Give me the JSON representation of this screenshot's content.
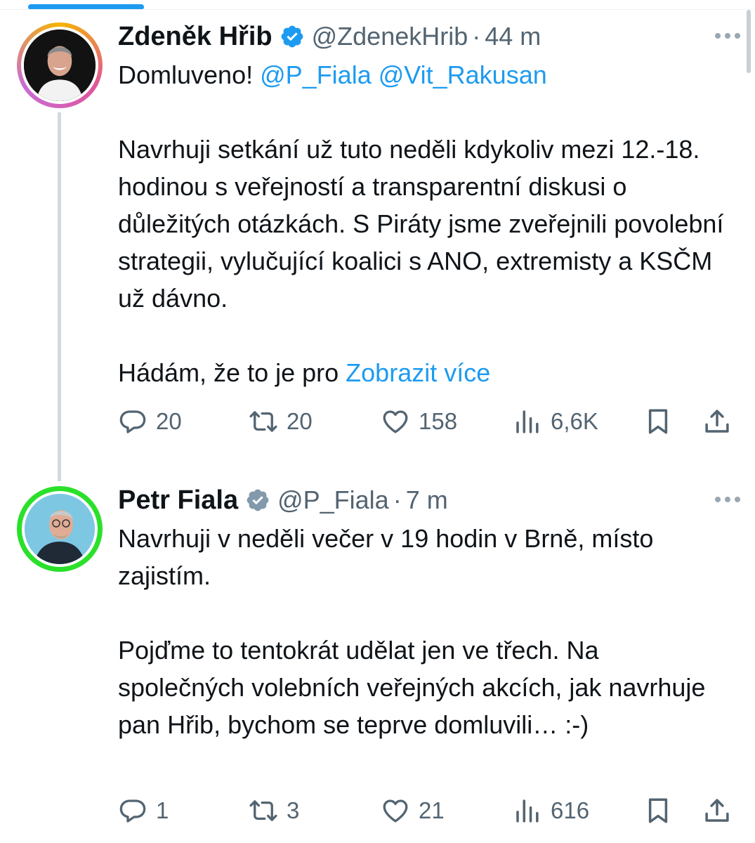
{
  "tweets": [
    {
      "display_name": "Zdeněk Hřib",
      "handle": "@ZdenekHrib",
      "separator": "·",
      "time": "44 m",
      "paragraphs": [
        {
          "text": "Domluveno! ",
          "mentions": [
            "@P_Fiala",
            "@Vit_Rakusan"
          ]
        },
        {
          "text": ""
        },
        {
          "text": "Navrhuji setkání už tuto neděli kdykoliv mezi 12.-18. hodinou s veřejností a transparentní diskusi o důležitých otázkách. S Piráty jsme zveřejnili povolební strategii, vylučující koalici s ANO, extremisty a KSČM už dávno."
        },
        {
          "text": ""
        },
        {
          "text": "Hádám, že to je pro ",
          "show_more": "Zobrazit více"
        }
      ],
      "stats": {
        "replies": "20",
        "retweets": "20",
        "likes": "158",
        "views": "6,6K"
      }
    },
    {
      "display_name": "Petr Fiala",
      "handle": "@P_Fiala",
      "separator": "·",
      "time": "7 m",
      "paragraphs": [
        {
          "text": "Navrhuji v neděli večer v 19 hodin v Brně, místo zajistím."
        },
        {
          "text": ""
        },
        {
          "text": "Pojďme to tentokrát udělat jen ve třech. Na společných volebních veřejných akcích, jak navrhuje pan Hřib, bychom se teprve domluvili… :-)"
        }
      ],
      "stats": {
        "replies": "1",
        "retweets": "3",
        "likes": "21",
        "views": "616"
      }
    }
  ],
  "icons": {
    "verified": "verified-badge-icon",
    "more": "more-dots-icon",
    "reply": "reply-icon",
    "retweet": "retweet-icon",
    "like": "heart-icon",
    "views": "views-chart-icon",
    "bookmark": "bookmark-icon",
    "share": "share-icon"
  },
  "colors": {
    "link": "#1d9bf0",
    "secondary_text": "#536471",
    "primary_text": "#0f1419",
    "verified_badge_1": "#1d9bf0",
    "verified_badge_2": "#829aab",
    "avatar_ring_2": "#2be02b"
  }
}
